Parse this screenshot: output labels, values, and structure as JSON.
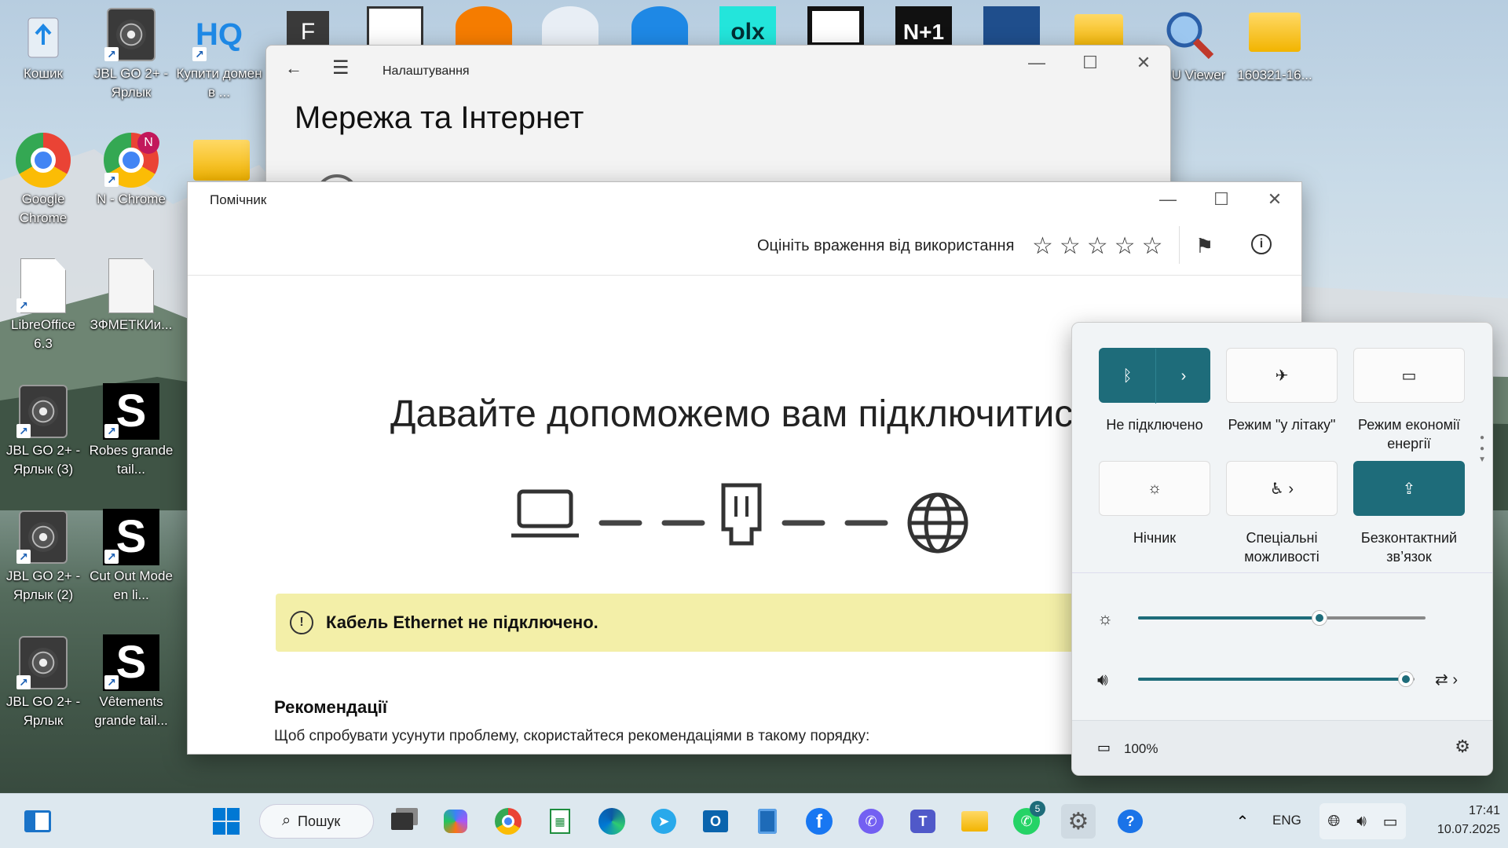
{
  "desktop": {
    "icons": [
      {
        "label": "Кошик",
        "icon": "recycle-bin-icon"
      },
      {
        "label": "JBL GO 2+ - Ярлык",
        "icon": "speaker-icon"
      },
      {
        "label": "Купити домен в ...",
        "icon": "hq-icon"
      },
      {
        "label": "Google Chrome",
        "icon": "chrome-icon"
      },
      {
        "label": "N - Chrome",
        "icon": "chrome-profile-icon",
        "badge": "N"
      },
      {
        "label": "LibreOffice 6.3",
        "icon": "libreoffice-icon"
      },
      {
        "label": "ЗФМЕТКИи...",
        "icon": "document-icon"
      },
      {
        "label": "JBL GO 2+ - Ярлык (3)",
        "icon": "speaker-icon"
      },
      {
        "label": "Robes grande tail...",
        "icon": "s-app-icon"
      },
      {
        "label": "JBL GO 2+ - Ярлык (2)",
        "icon": "speaker-icon"
      },
      {
        "label": "Cut Out Mode en li...",
        "icon": "s-app-icon"
      },
      {
        "label": "JBL GO 2+ - Ярлык",
        "icon": "speaker-icon"
      },
      {
        "label": "Vêtements grande tail...",
        "icon": "s-app-icon"
      },
      {
        "label": "U Viewer",
        "icon": "magnifier-icon"
      },
      {
        "label": "160321-16...",
        "icon": "folder-icon"
      }
    ],
    "top_letter": "F",
    "top_labels": [
      "olx",
      "N+1"
    ]
  },
  "settings_window": {
    "title": "Налаштування",
    "heading": "Мережа та Інтернет"
  },
  "helper_window": {
    "title": "Помічник",
    "rate_text": "Оцініть враження від використання",
    "headline": "Давайте допоможемо вам підключитися",
    "alert": "Кабель Ethernet не підключено.",
    "recommendations_title": "Рекомендації",
    "recommendations_text": "Щоб спробувати усунути проблему, скористайтеся рекомендаціями в такому порядку:"
  },
  "quick_settings": {
    "tiles": [
      {
        "label": "Не підключено",
        "icon": "bluetooth-icon",
        "active": true
      },
      {
        "label": "Режим \"у літаку\"",
        "icon": "airplane-icon",
        "active": false
      },
      {
        "label": "Режим економії енергії",
        "icon": "battery-saver-icon",
        "active": false
      },
      {
        "label": "Нічник",
        "icon": "night-light-icon",
        "active": false
      },
      {
        "label": "Спеціальні можливості",
        "icon": "accessibility-icon",
        "active": false
      },
      {
        "label": "Безконтактний зв’язок",
        "icon": "share-icon",
        "active": true
      }
    ],
    "brightness": 0.63,
    "volume": 0.97,
    "battery": "100%"
  },
  "taskbar": {
    "search_label": "Пошук",
    "language": "ENG",
    "time": "17:41",
    "date": "10.07.2025",
    "whatsapp_badge": "5"
  },
  "colors": {
    "accent": "#1e6c7a",
    "alert_bg": "#f3efa8"
  }
}
